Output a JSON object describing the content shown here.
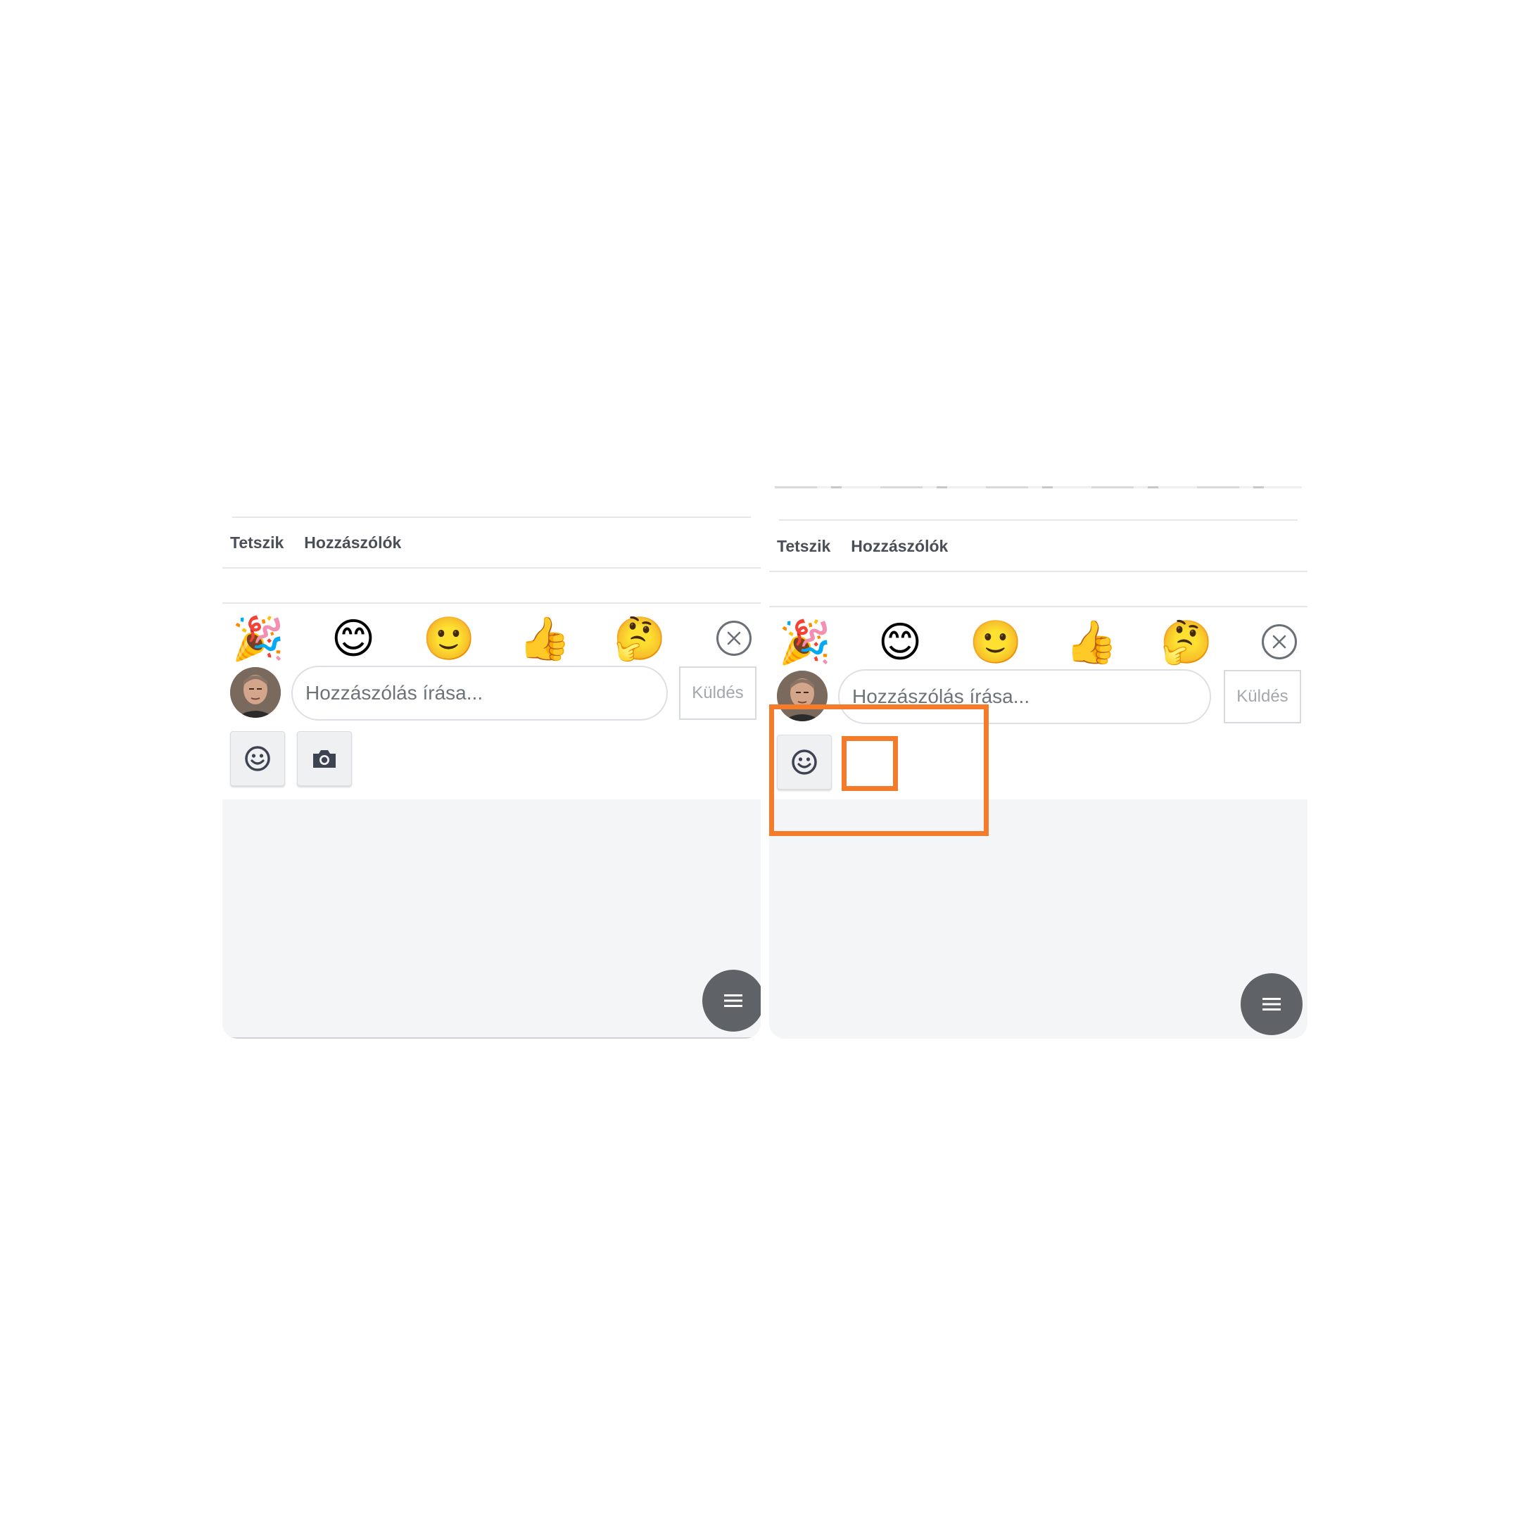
{
  "panels": {
    "left": {
      "actions": {
        "like": "Tetszik",
        "comments": "Hozzászólók"
      },
      "emojis": [
        {
          "glyph": "🎉",
          "name": "party-popper"
        },
        {
          "glyph": "😊",
          "name": "smiling-blush"
        },
        {
          "glyph": "🙂",
          "name": "slight-smile"
        },
        {
          "glyph": "👍",
          "name": "thumbs-up"
        },
        {
          "glyph": "🤔",
          "name": "thinking-face"
        }
      ],
      "comment": {
        "placeholder": "Hozzászólás írása...",
        "send_label": "Küldés"
      },
      "tools": [
        "emoji-picker-icon",
        "camera-icon"
      ],
      "menu_icon": "hamburger-menu-icon"
    },
    "right": {
      "actions": {
        "like": "Tetszik",
        "comments": "Hozzászólók"
      },
      "emojis": [
        {
          "glyph": "🎉",
          "name": "party-popper"
        },
        {
          "glyph": "😊",
          "name": "smiling-blush"
        },
        {
          "glyph": "🙂",
          "name": "slight-smile"
        },
        {
          "glyph": "👍",
          "name": "thumbs-up"
        },
        {
          "glyph": "🤔",
          "name": "thinking-face"
        }
      ],
      "comment": {
        "placeholder": "Hozzászólás írása...",
        "send_label": "Küldés"
      },
      "tools": [
        "emoji-picker-icon"
      ],
      "menu_icon": "hamburger-menu-icon"
    }
  },
  "colors": {
    "highlight": "#f47b2a",
    "fab": "#5f6266",
    "grey_area": "#f4f5f6",
    "icon": "#3d4350"
  }
}
